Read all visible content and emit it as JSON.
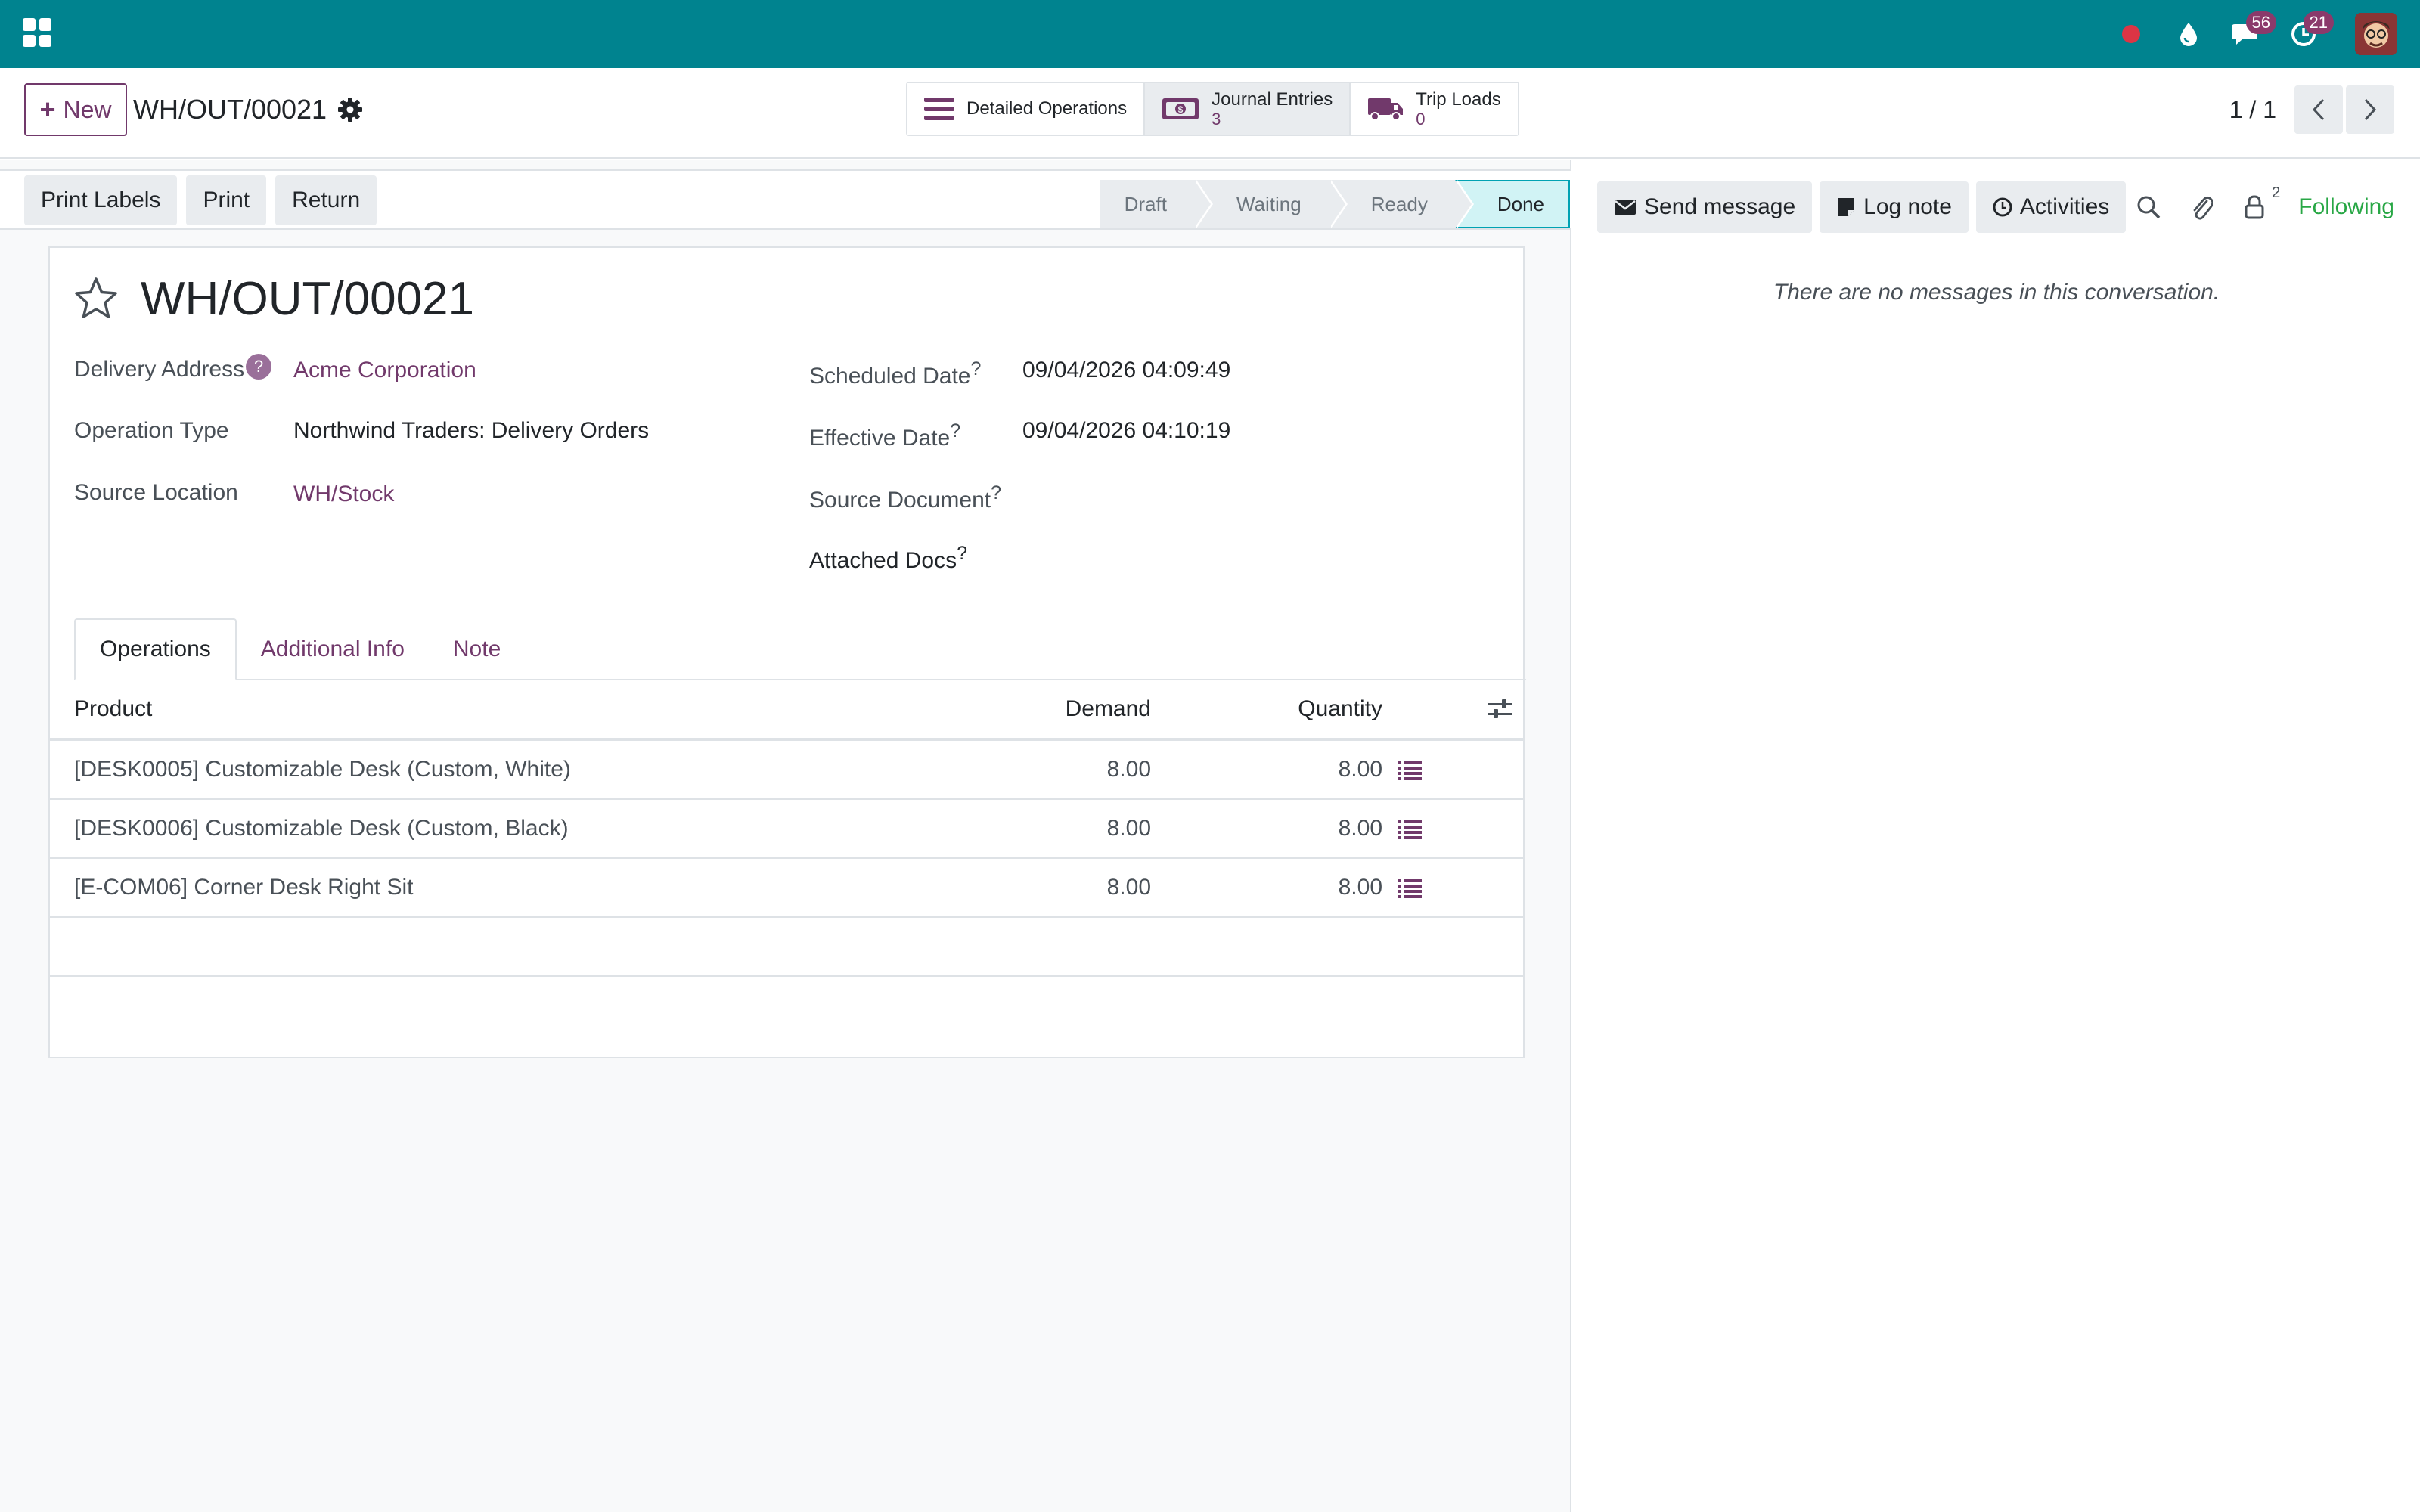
{
  "navbar": {
    "apps_icon": "apps-grid-icon",
    "messages_badge": "56",
    "activities_badge": "21",
    "status_dot_color": "#dc3545",
    "bar_color": "#00838f"
  },
  "control_panel": {
    "new_label": "New",
    "breadcrumb_title": "WH/OUT/00021",
    "smart_buttons": [
      {
        "label": "Detailed Operations",
        "count": ""
      },
      {
        "label": "Journal Entries",
        "count": "3"
      },
      {
        "label": "Trip Loads",
        "count": "0"
      }
    ],
    "pager_value": "1 / 1"
  },
  "statusbar": {
    "actions": [
      "Print Labels",
      "Print",
      "Return"
    ],
    "stages": [
      "Draft",
      "Waiting",
      "Ready",
      "Done"
    ],
    "active_stage": "Done"
  },
  "record": {
    "title": "WH/OUT/00021",
    "left_fields": [
      {
        "label": "Delivery Address",
        "value": "Acme Corporation",
        "help": "?"
      },
      {
        "label": "Operation Type",
        "value": "Northwind Traders: Delivery Orders"
      },
      {
        "label": "Source Location",
        "value": "WH/Stock"
      }
    ],
    "right_fields": [
      {
        "label": "Scheduled Date",
        "value": "09/04/2026 04:09:49",
        "help": "?"
      },
      {
        "label": "Effective Date",
        "value": "09/04/2026 04:10:19",
        "help": "?"
      },
      {
        "label": "Source Document",
        "value": "",
        "help": "?"
      },
      {
        "label": "Attached Docs",
        "value": "",
        "help": "?"
      }
    ]
  },
  "tabs": [
    "Operations",
    "Additional Info",
    "Note"
  ],
  "operations_table": {
    "headers": {
      "product": "Product",
      "demand": "Demand",
      "quantity": "Quantity"
    },
    "rows": [
      {
        "product": "[DESK0005] Customizable Desk (Custom, White)",
        "demand": "8.00",
        "quantity": "8.00"
      },
      {
        "product": "[DESK0006] Customizable Desk (Custom, Black)",
        "demand": "8.00",
        "quantity": "8.00"
      },
      {
        "product": "[E-COM06] Corner Desk Right Sit",
        "demand": "8.00",
        "quantity": "8.00"
      }
    ]
  },
  "chatter": {
    "send_message": "Send message",
    "log_note": "Log note",
    "activities": "Activities",
    "follower_count": "2",
    "following": "Following",
    "empty_text": "There are no messages in this conversation."
  },
  "colors": {
    "brand": "#71396b",
    "done_stage_bg": "#d1f3f5",
    "following": "#28a745"
  }
}
